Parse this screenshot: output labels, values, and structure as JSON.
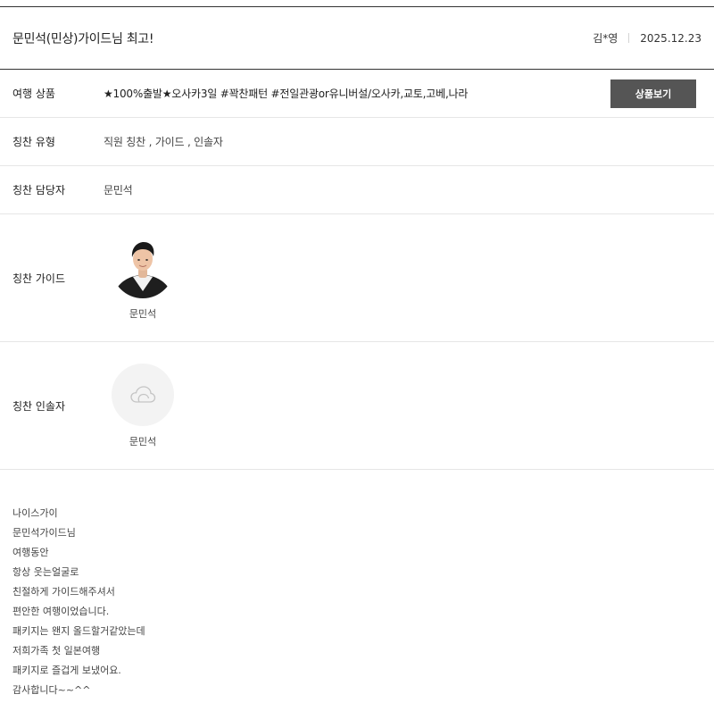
{
  "header": {
    "title": "문민석(민상)가이드님 최고!",
    "author": "김*영",
    "date": "2025.12.23"
  },
  "rows": {
    "product": {
      "label": "여행 상품",
      "value": "★100%출발★오사카3일 #꽉찬패턴 #전일관광or유니버설/오사카,교토,고베,나라",
      "button": "상품보기"
    },
    "type": {
      "label": "칭찬 유형",
      "value": "직원 칭찬 , 가이드 , 인솔자"
    },
    "staff": {
      "label": "칭찬 담당자",
      "value": "문민석"
    },
    "guide": {
      "label": "칭찬 가이드",
      "name": "문민석"
    },
    "leader": {
      "label": "칭찬 인솔자",
      "name": "문민석"
    }
  },
  "content": {
    "lines": [
      "나이스가이",
      "문민석가이드님",
      "여행동안",
      "항상 웃는얼굴로",
      "친절하게 가이드해주셔서",
      "편안한 여행이었습니다.",
      "패키지는 왠지 올드할거같았는데",
      "저희가족 첫 일본여행",
      "패키지로 즐겁게 보냈어요.",
      "감사합니다~~^^"
    ]
  },
  "icons": {
    "guide_avatar": "person-photo-icon",
    "leader_avatar": "cloud-placeholder-icon"
  },
  "colors": {
    "button_bg": "#555555",
    "divider": "#e6e6e6"
  }
}
